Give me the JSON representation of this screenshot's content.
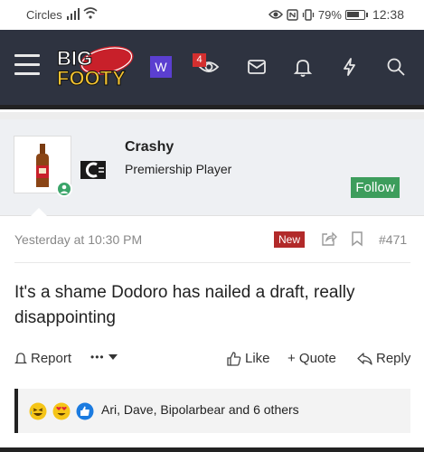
{
  "status_bar": {
    "carrier": "Circles",
    "battery": "79%",
    "battery_level": 0.79,
    "time": "12:38"
  },
  "nav": {
    "logo_top": "BIG",
    "logo_bottom": "FOOTY",
    "w_label": "W",
    "notifications_count": "4",
    "icons": [
      "menu-icon",
      "eye-icon",
      "mail-icon",
      "bell-icon",
      "bolt-icon",
      "search-icon"
    ]
  },
  "user": {
    "name": "Crashy",
    "title": "Premiership Player",
    "follow_label": "Follow"
  },
  "post": {
    "date": "Yesterday at 10:30 PM",
    "new_label": "New",
    "number": "#471",
    "body": "It's a shame Dodoro has nailed a draft, really disappointing"
  },
  "actions": {
    "report": "Report",
    "more": "•••",
    "like": "Like",
    "quote": "+ Quote",
    "reply": "Reply"
  },
  "reactions": {
    "text": "Ari, Dave, Bipolarbear and 6 others",
    "types": [
      "laughing",
      "heart-eyes",
      "like"
    ]
  },
  "colors": {
    "nav_bg": "#2e3340",
    "follow_green": "#3d9d5c",
    "new_red": "#b22a2a",
    "badge_red": "#d32f2f",
    "w_purple": "#5b3fd0"
  }
}
